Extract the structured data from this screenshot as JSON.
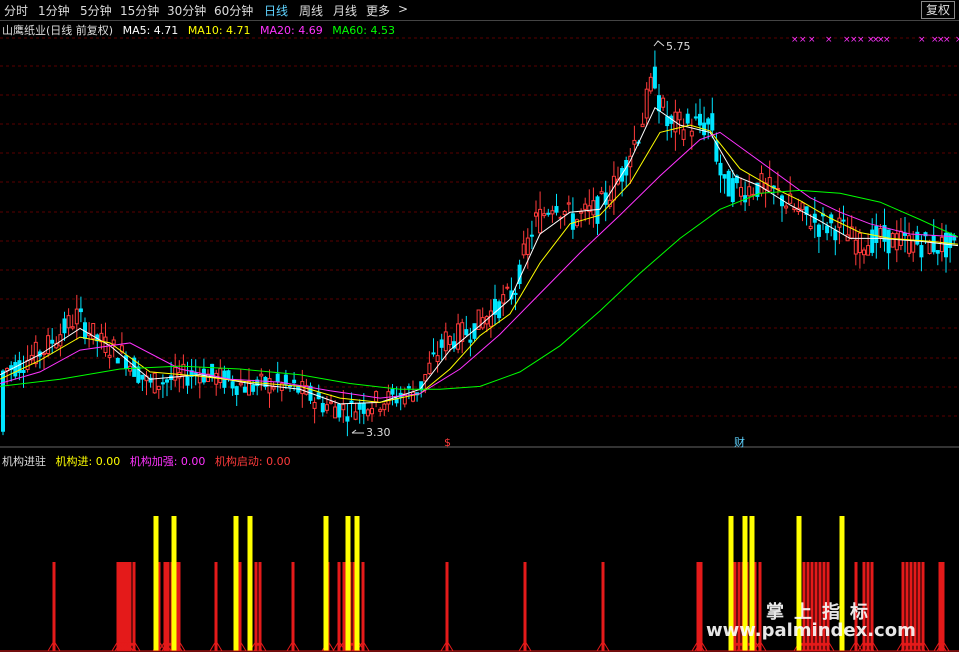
{
  "toolbar": {
    "periods": [
      "分时",
      "1分钟",
      "5分钟",
      "15分钟",
      "30分钟",
      "60分钟",
      "日线",
      "周线",
      "月线",
      "更多"
    ],
    "active": "日线",
    "more_arrow": ">",
    "adjust_button": "复权"
  },
  "main_legend": {
    "name": "山鹰纸业(日线 前复权)",
    "ma5": "MA5: 4.71",
    "ma10": "MA10: 4.71",
    "ma20": "MA20: 4.69",
    "ma60": "MA60: 4.53"
  },
  "annotations": {
    "high_label": "5.75",
    "low_label": "3.30",
    "marker_s": "$",
    "marker_cai": "财"
  },
  "indicator_legend": {
    "name": "机构进驻",
    "a": "机构进: 0.00",
    "b": "机构加强: 0.00",
    "c": "机构启动: 0.00"
  },
  "watermark": {
    "line1": "掌上指标",
    "line2": "www.palmindex.com"
  },
  "colors": {
    "up": "#ff3b3b",
    "down": "#00e5ff",
    "ma5": "#ffffff",
    "ma10": "#ffff00",
    "ma20": "#ff33ff",
    "ma60": "#00ff00",
    "bar_red": "#e41a1a",
    "bar_yellow": "#ffff00"
  },
  "chart_data": [
    {
      "type": "line",
      "title": "山鹰纸业(日线 前复权)",
      "ylim": [
        3.2,
        5.9
      ],
      "price_path": [
        [
          0,
          3.6
        ],
        [
          20,
          3.65
        ],
        [
          45,
          3.75
        ],
        [
          78,
          3.98
        ],
        [
          100,
          3.82
        ],
        [
          125,
          3.72
        ],
        [
          150,
          3.52
        ],
        [
          175,
          3.55
        ],
        [
          200,
          3.6
        ],
        [
          225,
          3.55
        ],
        [
          250,
          3.5
        ],
        [
          275,
          3.52
        ],
        [
          300,
          3.48
        ],
        [
          325,
          3.38
        ],
        [
          350,
          3.34
        ],
        [
          370,
          3.38
        ],
        [
          395,
          3.42
        ],
        [
          420,
          3.48
        ],
        [
          445,
          3.8
        ],
        [
          470,
          3.88
        ],
        [
          495,
          4.02
        ],
        [
          515,
          4.15
        ],
        [
          535,
          4.6
        ],
        [
          555,
          4.78
        ],
        [
          575,
          4.65
        ],
        [
          600,
          4.72
        ],
        [
          620,
          4.92
        ],
        [
          640,
          5.25
        ],
        [
          655,
          5.6
        ],
        [
          670,
          5.3
        ],
        [
          690,
          5.3
        ],
        [
          712,
          5.3
        ],
        [
          725,
          4.9
        ],
        [
          740,
          4.85
        ],
        [
          760,
          4.88
        ],
        [
          780,
          4.82
        ],
        [
          800,
          4.7
        ],
        [
          820,
          4.62
        ],
        [
          840,
          4.6
        ],
        [
          860,
          4.48
        ],
        [
          880,
          4.52
        ],
        [
          900,
          4.5
        ],
        [
          930,
          4.48
        ],
        [
          958,
          4.46
        ]
      ],
      "series": [
        {
          "name": "MA5",
          "values": [
            [
              0,
              3.58
            ],
            [
              40,
              3.72
            ],
            [
              80,
              3.9
            ],
            [
              110,
              3.78
            ],
            [
              150,
              3.55
            ],
            [
              200,
              3.58
            ],
            [
              250,
              3.52
            ],
            [
              300,
              3.48
            ],
            [
              340,
              3.38
            ],
            [
              380,
              3.39
            ],
            [
              420,
              3.48
            ],
            [
              450,
              3.75
            ],
            [
              480,
              3.92
            ],
            [
              510,
              4.1
            ],
            [
              540,
              4.55
            ],
            [
              570,
              4.7
            ],
            [
              600,
              4.72
            ],
            [
              630,
              5.05
            ],
            [
              655,
              5.42
            ],
            [
              680,
              5.3
            ],
            [
              710,
              5.25
            ],
            [
              735,
              4.95
            ],
            [
              760,
              4.88
            ],
            [
              790,
              4.75
            ],
            [
              820,
              4.64
            ],
            [
              850,
              4.52
            ],
            [
              880,
              4.52
            ],
            [
              920,
              4.5
            ],
            [
              958,
              4.47
            ]
          ]
        },
        {
          "name": "MA10",
          "values": [
            [
              0,
              3.55
            ],
            [
              40,
              3.68
            ],
            [
              80,
              3.84
            ],
            [
              110,
              3.8
            ],
            [
              150,
              3.6
            ],
            [
              200,
              3.57
            ],
            [
              250,
              3.53
            ],
            [
              300,
              3.5
            ],
            [
              340,
              3.42
            ],
            [
              380,
              3.39
            ],
            [
              420,
              3.45
            ],
            [
              450,
              3.62
            ],
            [
              480,
              3.85
            ],
            [
              510,
              4.0
            ],
            [
              540,
              4.35
            ],
            [
              570,
              4.62
            ],
            [
              600,
              4.68
            ],
            [
              630,
              4.9
            ],
            [
              660,
              5.25
            ],
            [
              690,
              5.3
            ],
            [
              710,
              5.26
            ],
            [
              740,
              5.0
            ],
            [
              770,
              4.88
            ],
            [
              800,
              4.78
            ],
            [
              830,
              4.66
            ],
            [
              860,
              4.56
            ],
            [
              890,
              4.52
            ],
            [
              930,
              4.5
            ],
            [
              958,
              4.48
            ]
          ]
        },
        {
          "name": "MA20",
          "values": [
            [
              0,
              3.52
            ],
            [
              40,
              3.6
            ],
            [
              80,
              3.75
            ],
            [
              130,
              3.8
            ],
            [
              180,
              3.62
            ],
            [
              230,
              3.55
            ],
            [
              280,
              3.53
            ],
            [
              330,
              3.47
            ],
            [
              380,
              3.42
            ],
            [
              420,
              3.45
            ],
            [
              460,
              3.62
            ],
            [
              500,
              3.86
            ],
            [
              540,
              4.14
            ],
            [
              580,
              4.42
            ],
            [
              620,
              4.68
            ],
            [
              660,
              4.95
            ],
            [
              700,
              5.2
            ],
            [
              720,
              5.25
            ],
            [
              750,
              5.1
            ],
            [
              780,
              4.95
            ],
            [
              810,
              4.8
            ],
            [
              840,
              4.7
            ],
            [
              870,
              4.62
            ],
            [
              910,
              4.55
            ],
            [
              958,
              4.53
            ]
          ]
        },
        {
          "name": "MA60",
          "values": [
            [
              0,
              3.5
            ],
            [
              60,
              3.55
            ],
            [
              120,
              3.62
            ],
            [
              180,
              3.64
            ],
            [
              240,
              3.62
            ],
            [
              300,
              3.58
            ],
            [
              350,
              3.52
            ],
            [
              400,
              3.48
            ],
            [
              440,
              3.48
            ],
            [
              480,
              3.5
            ],
            [
              520,
              3.6
            ],
            [
              560,
              3.78
            ],
            [
              600,
              4.02
            ],
            [
              640,
              4.28
            ],
            [
              680,
              4.52
            ],
            [
              720,
              4.72
            ],
            [
              760,
              4.83
            ],
            [
              800,
              4.85
            ],
            [
              840,
              4.83
            ],
            [
              880,
              4.77
            ],
            [
              920,
              4.65
            ],
            [
              958,
              4.53
            ]
          ]
        }
      ]
    },
    {
      "type": "bar",
      "title": "机构进驻",
      "red_positions": [
        54,
        118,
        121,
        124,
        127,
        130,
        134,
        159,
        165,
        168,
        172,
        176,
        179,
        216,
        240,
        256,
        260,
        293,
        328,
        339,
        344,
        350,
        354,
        358,
        363,
        447,
        525,
        603,
        698,
        701,
        735,
        739,
        743,
        747,
        751,
        755,
        760,
        800,
        804,
        808,
        812,
        816,
        820,
        824,
        828,
        856,
        864,
        868,
        872,
        903,
        907,
        911,
        915,
        919,
        923,
        940,
        943
      ],
      "yellow_positions": [
        156,
        174,
        236,
        250,
        326,
        348,
        357,
        731,
        745,
        752,
        799,
        842
      ]
    }
  ]
}
